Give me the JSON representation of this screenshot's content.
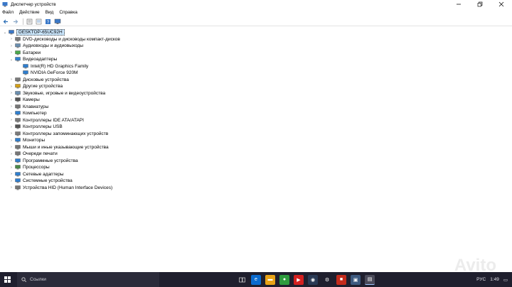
{
  "window": {
    "title": "Диспетчер устройств"
  },
  "menu": [
    "Файл",
    "Действие",
    "Вид",
    "Справка"
  ],
  "tree": {
    "root": "DESKTOP-65UC92H",
    "items": [
      {
        "label": "DVD-дисководы и дисководы компакт-дисков",
        "expanded": false,
        "icon": "dvd-icon",
        "color": "#7a7a7a"
      },
      {
        "label": "Аудиовходы и аудиовыходы",
        "expanded": false,
        "icon": "speaker-icon",
        "color": "#6b8fb0"
      },
      {
        "label": "Батареи",
        "expanded": false,
        "icon": "battery-icon",
        "color": "#4aa84a"
      },
      {
        "label": "Видеоадаптеры",
        "expanded": true,
        "icon": "display-adapter-icon",
        "color": "#2f7fd0",
        "children": [
          "Intel(R) HD Graphics Family",
          "NVIDIA GeForce 920M"
        ]
      },
      {
        "label": "Дисковые устройства",
        "expanded": false,
        "icon": "disk-icon",
        "color": "#7a7a7a"
      },
      {
        "label": "Другие устройства",
        "expanded": false,
        "icon": "unknown-device-icon",
        "color": "#d4a017"
      },
      {
        "label": "Звуковые, игровые и видеоустройства",
        "expanded": false,
        "icon": "sound-icon",
        "color": "#6b8fb0"
      },
      {
        "label": "Камеры",
        "expanded": false,
        "icon": "camera-icon",
        "color": "#555555"
      },
      {
        "label": "Клавиатуры",
        "expanded": false,
        "icon": "keyboard-icon",
        "color": "#777777"
      },
      {
        "label": "Компьютер",
        "expanded": false,
        "icon": "computer-icon",
        "color": "#2f7fd0"
      },
      {
        "label": "Контроллеры IDE ATA/ATAPI",
        "expanded": false,
        "icon": "ide-icon",
        "color": "#7a7a7a"
      },
      {
        "label": "Контроллеры USB",
        "expanded": false,
        "icon": "usb-icon",
        "color": "#555555"
      },
      {
        "label": "Контроллеры запоминающих устройств",
        "expanded": false,
        "icon": "storage-icon",
        "color": "#7a7a7a"
      },
      {
        "label": "Мониторы",
        "expanded": false,
        "icon": "monitor-icon",
        "color": "#2f7fd0"
      },
      {
        "label": "Мыши и иные указывающие устройства",
        "expanded": false,
        "icon": "mouse-icon",
        "color": "#777777"
      },
      {
        "label": "Очереди печати",
        "expanded": false,
        "icon": "printer-icon",
        "color": "#777777"
      },
      {
        "label": "Программные устройства",
        "expanded": false,
        "icon": "software-device-icon",
        "color": "#2f7fd0"
      },
      {
        "label": "Процессоры",
        "expanded": false,
        "icon": "processor-icon",
        "color": "#4a8a4a"
      },
      {
        "label": "Сетевые адаптеры",
        "expanded": false,
        "icon": "network-icon",
        "color": "#2f7fd0"
      },
      {
        "label": "Системные устройства",
        "expanded": false,
        "icon": "system-icon",
        "color": "#2f7fd0"
      },
      {
        "label": "Устройства HID (Human Interface Devices)",
        "expanded": false,
        "icon": "hid-icon",
        "color": "#777777"
      }
    ]
  },
  "taskbar": {
    "search_placeholder": "Ссылки",
    "tray_language": "РУС",
    "tray_time": "1:49"
  },
  "watermark": "Avito"
}
